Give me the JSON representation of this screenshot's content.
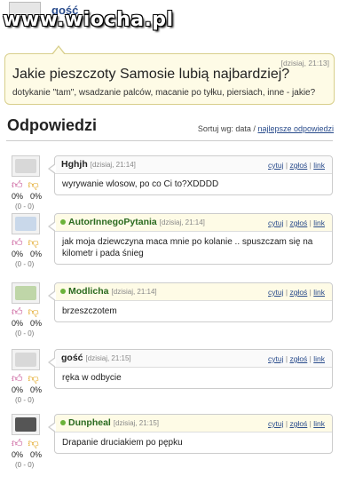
{
  "watermark": "www.wiocha.pl",
  "top_user": "gość",
  "question": {
    "time": "[dzisiaj, 21:13]",
    "title": "Jakie pieszczoty Samosie lubią najbardziej?",
    "subtitle": "dotykanie \"tam\", wsadzanie palców, macanie po tyłku, piersiach, inne - jakie?"
  },
  "answers_heading": "Odpowiedzi",
  "sort": {
    "prefix": "Sortuj wg: data / ",
    "link": "najlepsze odpowiedzi"
  },
  "actions": {
    "quote": "cytuj",
    "report": "zgłoś",
    "link": "link",
    "sep": " | "
  },
  "vote_labels": {
    "up_pct": "0%",
    "down_pct": "0%",
    "count": "(0 - 0)"
  },
  "answers": [
    {
      "user": "Hghjh",
      "time": "[dzisiaj, 21:14]",
      "text": "wyrywanie wlosow, po co Ci to?XDDDD"
    },
    {
      "user": "AutorInnegoPytania",
      "time": "[dzisiaj, 21:14]",
      "text": "jak moja dziewczyna maca mnie po kolanie .. spuszczam się na kilometr i pada śnieg"
    },
    {
      "user": "Modlicha",
      "time": "[dzisiaj, 21:14]",
      "text": "brzeszczotem"
    },
    {
      "user": "gość",
      "time": "[dzisiaj, 21:15]",
      "text": "ręka w odbycie"
    },
    {
      "user": "Dunpheal",
      "time": "[dzisiaj, 21:15]",
      "text": "Drapanie druciakiem po pępku"
    }
  ],
  "colors": {
    "accent_link": "#2a4c8c",
    "online_dot": "#6bb33a",
    "question_bg": "#fefbe6"
  }
}
